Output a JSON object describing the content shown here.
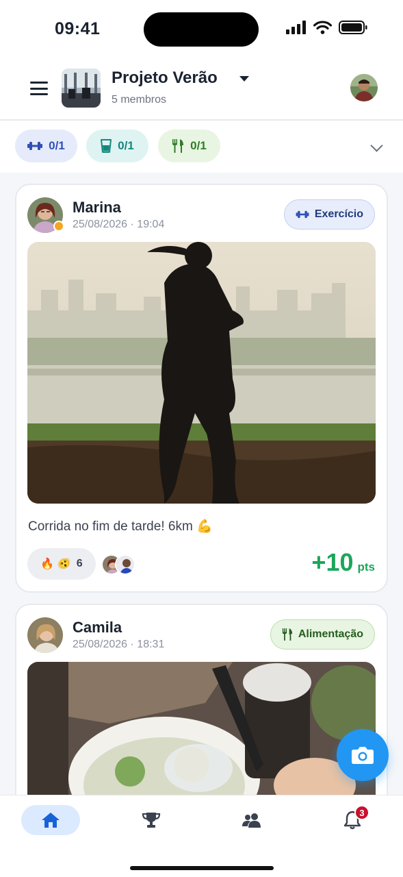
{
  "status_bar": {
    "time": "09:41"
  },
  "header": {
    "group_name": "Projeto Verão",
    "members": "5 membros"
  },
  "progress": [
    {
      "icon": "dumbbell-icon",
      "value": "0/1",
      "color": "#2f4fb6"
    },
    {
      "icon": "water-glass-icon",
      "value": "0/1",
      "color": "#14877d"
    },
    {
      "icon": "fork-knife-icon",
      "value": "0/1",
      "color": "#2f7d27"
    }
  ],
  "posts": [
    {
      "user": "Marina",
      "date": "25/08/2026 · 19:04",
      "category": "Exercício",
      "category_icon": "dumbbell-icon",
      "caption": "Corrida no fim de tarde! 6km 💪",
      "reactions": {
        "emojis": "🔥 🫨",
        "count": "6"
      },
      "points": "+10",
      "points_unit": "pts"
    },
    {
      "user": "Camila",
      "date": "25/08/2026 · 18:31",
      "category": "Alimentação",
      "category_icon": "fork-knife-icon"
    }
  ],
  "bottom_nav": {
    "active": "home",
    "notifications_count": "3"
  },
  "colors": {
    "accent": "#2196f3",
    "points": "#1ba65a",
    "badge": "#c8102e"
  }
}
